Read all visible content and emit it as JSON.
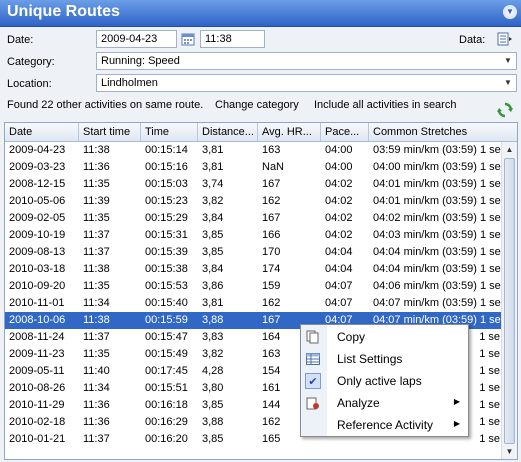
{
  "panel": {
    "title": "Unique Routes"
  },
  "form": {
    "date_label": "Date:",
    "date_value": "2009-04-23",
    "time_value": "11:38",
    "data_label": "Data:",
    "category_label": "Category:",
    "category_value": "Running: Speed",
    "location_label": "Location:",
    "location_value": "Lindholmen"
  },
  "status": {
    "found": "Found 22 other activities on same route.",
    "change_category": "Change category",
    "include_all": "Include all activities in search"
  },
  "icons": {
    "collapse": "chevron-down-icon",
    "calendar": "calendar-icon",
    "data": "data-table-icon",
    "refresh": "refresh-icon"
  },
  "colors": {
    "title_bar": "#2f63c8",
    "selection": "#3168c5"
  },
  "table": {
    "columns": [
      "Date",
      "Start time",
      "Time",
      "Distance...",
      "Avg. HR...",
      "Pace...",
      "Common Stretches"
    ],
    "selected_index": 10,
    "rows": [
      [
        "2009-04-23",
        "11:38",
        "00:15:14",
        "3,81",
        "163",
        "04:00",
        "03:59 min/km (03:59) 1 se"
      ],
      [
        "2009-03-23",
        "11:36",
        "00:15:16",
        "3,81",
        "NaN",
        "04:00",
        "04:00 min/km (03:59) 1 se"
      ],
      [
        "2008-12-15",
        "11:35",
        "00:15:03",
        "3,74",
        "167",
        "04:02",
        "04:01 min/km (03:59) 1 se"
      ],
      [
        "2010-05-06",
        "11:39",
        "00:15:23",
        "3,82",
        "162",
        "04:02",
        "04:01 min/km (03:59) 1 se"
      ],
      [
        "2009-02-05",
        "11:35",
        "00:15:29",
        "3,84",
        "167",
        "04:02",
        "04:02 min/km (03:59) 1 se"
      ],
      [
        "2009-10-19",
        "11:37",
        "00:15:31",
        "3,85",
        "166",
        "04:02",
        "04:03 min/km (03:59) 1 se"
      ],
      [
        "2009-08-13",
        "11:37",
        "00:15:39",
        "3,85",
        "170",
        "04:04",
        "04:04 min/km (03:59) 1 se"
      ],
      [
        "2010-03-18",
        "11:38",
        "00:15:38",
        "3,84",
        "174",
        "04:04",
        "04:04 min/km (03:59) 1 se"
      ],
      [
        "2010-09-20",
        "11:35",
        "00:15:53",
        "3,86",
        "159",
        "04:07",
        "04:06 min/km (03:59) 1 se"
      ],
      [
        "2010-11-01",
        "11:34",
        "00:15:40",
        "3,81",
        "162",
        "04:07",
        "04:07 min/km (03:59) 1 se"
      ],
      [
        "2008-10-06",
        "11:38",
        "00:15:59",
        "3,88",
        "167",
        "04:07",
        "04:07 min/km (03:59) 1 se"
      ],
      [
        "2008-11-24",
        "11:37",
        "00:15:47",
        "3,83",
        "164",
        "",
        "1 se"
      ],
      [
        "2009-11-23",
        "11:35",
        "00:15:49",
        "3,82",
        "163",
        "",
        "1 se"
      ],
      [
        "2009-05-11",
        "11:40",
        "00:17:45",
        "4,28",
        "154",
        "",
        "1 se"
      ],
      [
        "2010-08-26",
        "11:34",
        "00:15:51",
        "3,80",
        "161",
        "",
        "1 se"
      ],
      [
        "2010-11-29",
        "11:36",
        "00:16:18",
        "3,85",
        "144",
        "",
        "1 se"
      ],
      [
        "2010-02-18",
        "11:36",
        "00:16:29",
        "3,88",
        "162",
        "",
        "1 se"
      ],
      [
        "2010-01-21",
        "11:37",
        "00:16:20",
        "3,85",
        "165",
        "",
        "1 se"
      ]
    ]
  },
  "context_menu": {
    "items": [
      {
        "label": "Copy",
        "icon": "copy-icon"
      },
      {
        "label": "List Settings",
        "icon": "list-settings-icon"
      },
      {
        "label": "Only active laps",
        "icon": "checkmark-icon",
        "checked": true
      },
      {
        "label": "Analyze",
        "icon": "analyze-icon",
        "submenu": true
      },
      {
        "label": "Reference Activity",
        "icon": "",
        "submenu": true
      }
    ]
  }
}
